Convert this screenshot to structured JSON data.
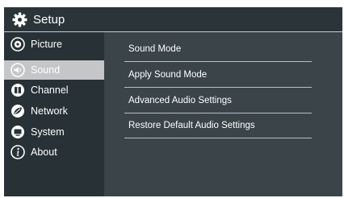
{
  "header": {
    "title": "Setup",
    "icon": "gear-icon"
  },
  "sidebar": {
    "items": [
      {
        "label": "Picture",
        "icon": "picture-icon"
      },
      {
        "label": "Sound",
        "icon": "speaker-icon",
        "selected": true
      },
      {
        "label": "Channel",
        "icon": "channel-icon"
      },
      {
        "label": "Network",
        "icon": "network-icon"
      },
      {
        "label": "System",
        "icon": "system-icon"
      },
      {
        "label": "About",
        "icon": "info-icon"
      }
    ]
  },
  "main": {
    "items": [
      {
        "label": "Sound Mode"
      },
      {
        "label": "Apply Sound Mode"
      },
      {
        "label": "Advanced Audio Settings"
      },
      {
        "label": "Restore Default Audio Settings"
      }
    ]
  },
  "colors": {
    "background": "#2a3338",
    "content_panel": "#3a4449",
    "selected_item": "#c4c6c8",
    "text": "#ffffff"
  }
}
